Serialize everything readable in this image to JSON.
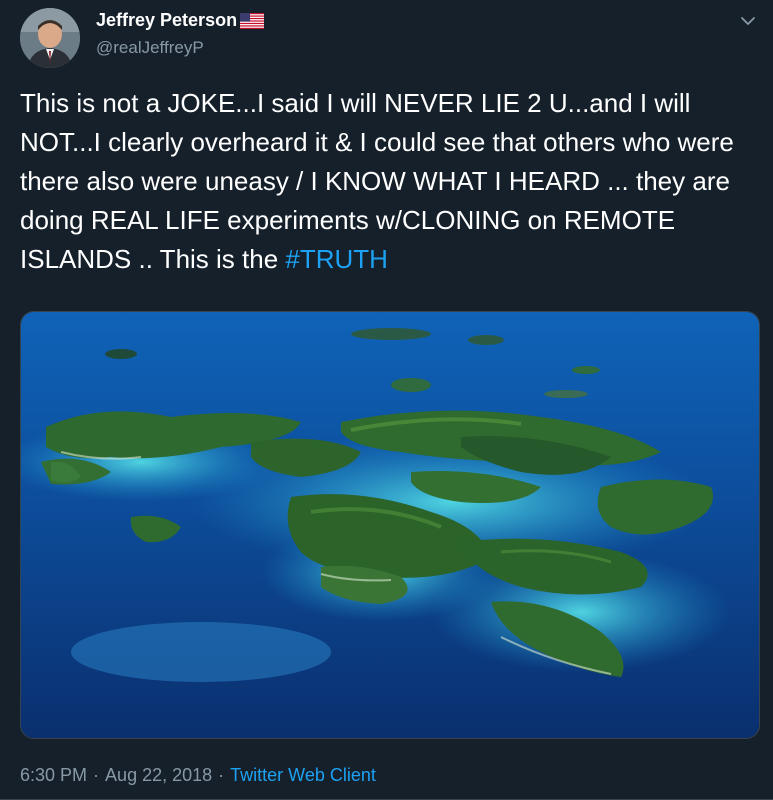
{
  "tweet": {
    "author": {
      "display_name": "Jeffrey Peterson",
      "handle": "@realJeffreyP"
    },
    "text_main": "This is not a JOKE...I said I will NEVER LIE 2 U...and I will NOT...I clearly overheard it & I could see that others who were there also were uneasy / I KNOW WHAT I HEARD ... they are doing REAL LIFE experiments w/CLONING on REMOTE ISLANDS .. This is the ",
    "hashtag": "#TRUTH",
    "time": "6:30 PM",
    "separator": "·",
    "date": "Aug 22, 2018",
    "source": "Twitter Web Client"
  },
  "icons": {
    "flag": "us-flag-icon",
    "caret": "chevron-down-icon"
  },
  "colors": {
    "background": "#15202b",
    "link": "#1da1f2",
    "secondary_text": "#8899a6"
  }
}
